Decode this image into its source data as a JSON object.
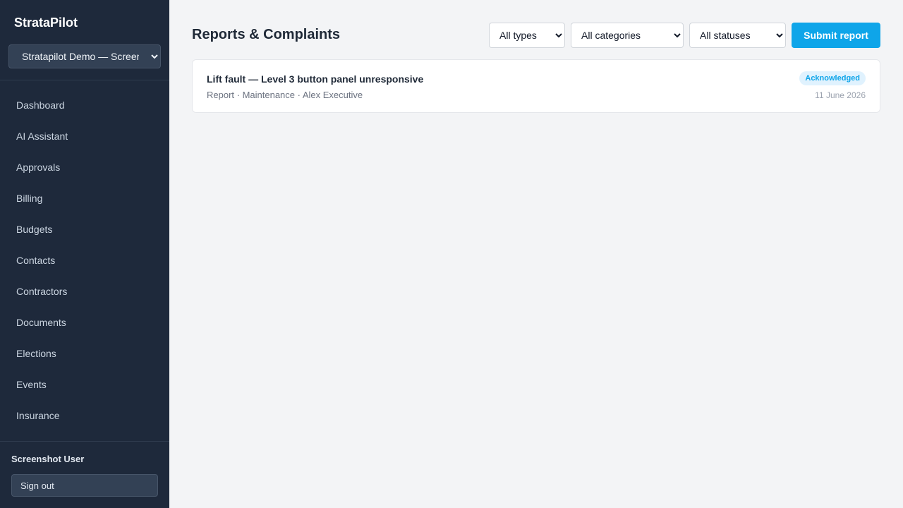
{
  "app": {
    "brand": "StrataPilot"
  },
  "sidebar": {
    "org_selected": "Stratapilot Demo — Screenshot",
    "items": [
      {
        "label": "Dashboard"
      },
      {
        "label": "AI Assistant"
      },
      {
        "label": "Approvals"
      },
      {
        "label": "Billing"
      },
      {
        "label": "Budgets"
      },
      {
        "label": "Contacts"
      },
      {
        "label": "Contractors"
      },
      {
        "label": "Documents"
      },
      {
        "label": "Elections"
      },
      {
        "label": "Events"
      },
      {
        "label": "Insurance"
      }
    ],
    "user_name": "Screenshot User",
    "signout_label": "Sign out"
  },
  "main": {
    "title": "Reports & Complaints",
    "filters": {
      "types": "All types",
      "categories": "All categories",
      "statuses": "All statuses"
    },
    "submit_label": "Submit report",
    "reports": [
      {
        "title": "Lift fault — Level 3 button panel unresponsive",
        "meta": "Report · Maintenance · Alex Executive",
        "status": "Acknowledged",
        "date": "11 June 2026"
      }
    ]
  },
  "colors": {
    "sidebar_bg": "#1e293b",
    "accent": "#0ea5e9",
    "page_bg": "#f3f4f6"
  }
}
